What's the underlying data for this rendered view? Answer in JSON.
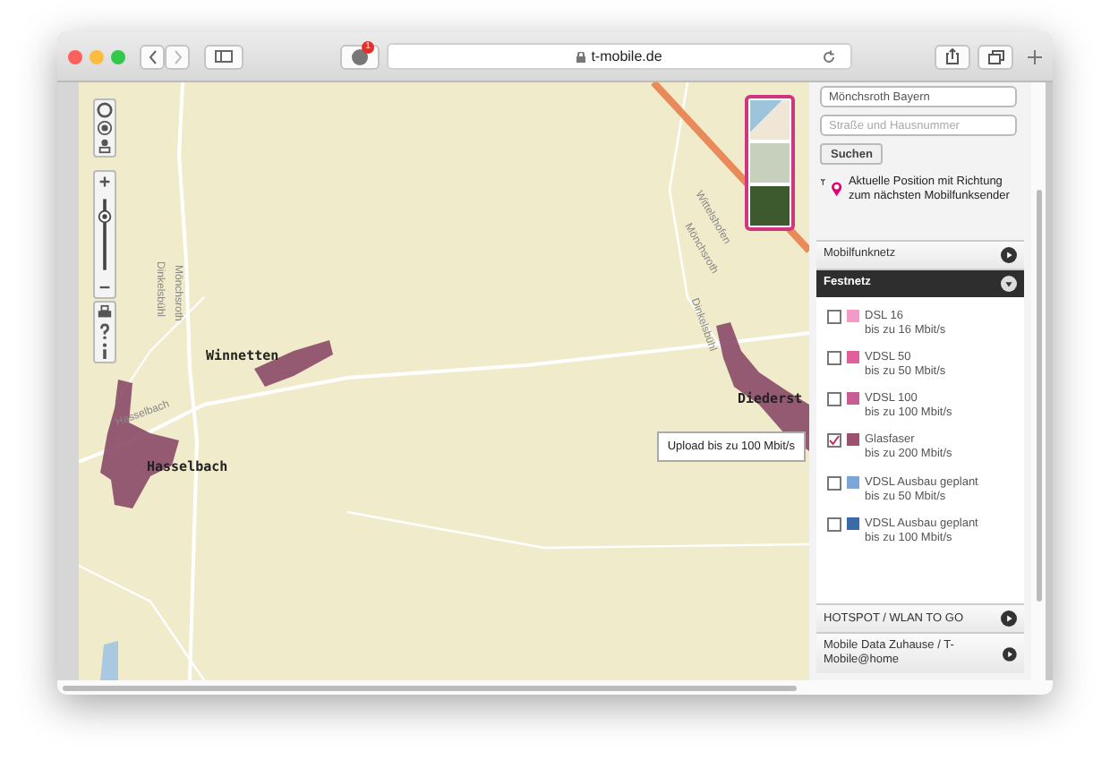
{
  "browser": {
    "url": "t-mobile.de",
    "extension_badge": "1"
  },
  "map": {
    "labels": [
      {
        "kind": "place",
        "text": "Winnetten"
      },
      {
        "kind": "place",
        "text": "Hasselbach"
      },
      {
        "kind": "place",
        "text": "Diederst"
      },
      {
        "kind": "road",
        "text": "Dinkelsbühl"
      },
      {
        "kind": "road",
        "text": "Mönchsroth"
      },
      {
        "kind": "road",
        "text": "Hasselbach"
      },
      {
        "kind": "road",
        "text": "Wittelshofen"
      },
      {
        "kind": "road",
        "text": "Mönchsroth"
      },
      {
        "kind": "road",
        "text": "Dinkelsbühl"
      }
    ],
    "tooltip": "Upload bis zu 100 Mbit/s",
    "zoom": {
      "level": 0.8
    }
  },
  "sidebar": {
    "location_field": {
      "value": "Mönchsroth Bayern"
    },
    "street_field": {
      "placeholder": "Straße und Hausnummer"
    },
    "search_button": "Suchen",
    "position_hint": "Aktuelle Position mit Richtung zum nächsten Mobilfunksender",
    "sections": [
      {
        "title": "Mobilfunknetz",
        "expanded": false
      },
      {
        "title": "Festnetz",
        "expanded": true,
        "items": [
          {
            "name": "DSL 16",
            "speed": "bis zu 16 Mbit/s",
            "color": "#f49ac8",
            "checked": false
          },
          {
            "name": "VDSL 50",
            "speed": "bis zu 50 Mbit/s",
            "color": "#e0609c",
            "checked": false
          },
          {
            "name": "VDSL 100",
            "speed": "bis zu 100 Mbit/s",
            "color": "#c85c94",
            "checked": false
          },
          {
            "name": "Glasfaser",
            "speed": "bis zu 200 Mbit/s",
            "color": "#9c5070",
            "checked": true
          },
          {
            "name": "VDSL Ausbau geplant",
            "speed": "bis zu 50 Mbit/s",
            "color": "#7aa6d8",
            "checked": false
          },
          {
            "name": "VDSL Ausbau geplant",
            "speed": "bis zu 100 Mbit/s",
            "color": "#3a6aa8",
            "checked": false
          }
        ]
      },
      {
        "title": "HOTSPOT / WLAN TO GO",
        "expanded": false
      },
      {
        "title": "Mobile Data Zuhause / T-Mobile@home",
        "expanded": false
      }
    ]
  }
}
